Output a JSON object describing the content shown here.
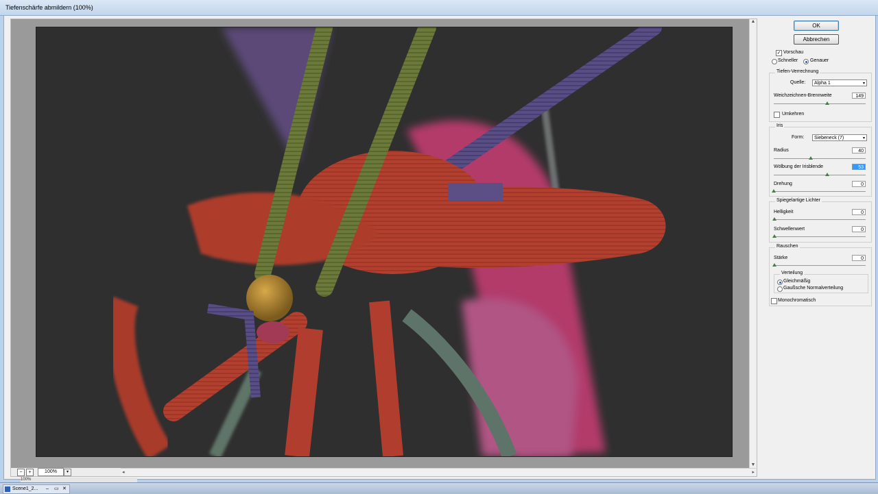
{
  "window": {
    "title": "Tiefenschärfe abmildern (100%)"
  },
  "preview": {
    "zoom": "100%"
  },
  "buttons": {
    "ok": "OK",
    "cancel": "Abbrechen"
  },
  "preview_group": {
    "preview_label": "Vorschau",
    "preview_checked": true,
    "faster": "Schneller",
    "more_accurate": "Genauer",
    "selected": "Genauer"
  },
  "depth_map": {
    "legend": "Tiefen-Verrechnung",
    "source_label": "Quelle:",
    "source_value": "Alpha 1",
    "blur_focal_label": "Weichzeichnen-Brennweite",
    "blur_focal_value": "149",
    "blur_focal_fraction": 0.58,
    "invert_label": "Umkehren",
    "invert_checked": false
  },
  "iris": {
    "legend": "Iris",
    "shape_label": "Form:",
    "shape_value": "Siebeneck (7)",
    "radius_label": "Radius",
    "radius_value": "40",
    "radius_fraction": 0.4,
    "curvature_label": "Wölbung der Irisblende",
    "curvature_value": "53",
    "curvature_fraction": 0.58,
    "rotation_label": "Drehung",
    "rotation_value": "0",
    "rotation_fraction": 0.0
  },
  "specular": {
    "legend": "Spiegelartige Lichter",
    "brightness_label": "Helligkeit",
    "brightness_value": "0",
    "threshold_label": "Schwellenwert",
    "threshold_value": "0"
  },
  "noise": {
    "legend": "Rauschen",
    "amount_label": "Stärke",
    "amount_value": "0",
    "distribution_legend": "Verteilung",
    "uniform": "Gleichmäßig",
    "gaussian": "Gaußsche Normalverteilung",
    "selected": "Gleichmäßig",
    "mono_label": "Monochromatisch",
    "mono_checked": false
  },
  "statusbar": {
    "text": "100%"
  },
  "taskbar": {
    "item_label": "Scene1_2..."
  }
}
